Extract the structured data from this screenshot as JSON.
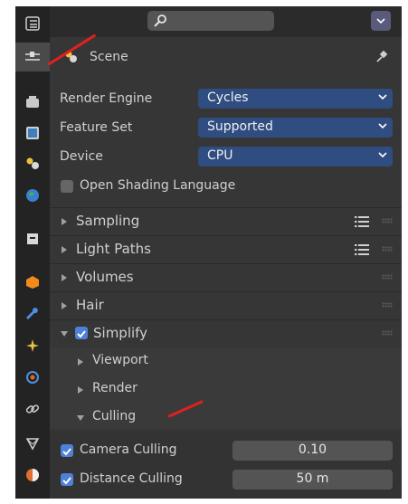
{
  "header": {
    "search_icon": "search-icon"
  },
  "scene": {
    "label": "Scene"
  },
  "render": {
    "engine_label": "Render Engine",
    "engine_value": "Cycles",
    "feature_label": "Feature Set",
    "feature_value": "Supported",
    "device_label": "Device",
    "device_value": "CPU",
    "osl_label": "Open Shading Language"
  },
  "panels": {
    "sampling": "Sampling",
    "light_paths": "Light Paths",
    "volumes": "Volumes",
    "hair": "Hair",
    "simplify": "Simplify",
    "viewport": "Viewport",
    "render": "Render",
    "culling": "Culling"
  },
  "culling": {
    "camera_label": "Camera Culling",
    "camera_value": "0.10",
    "distance_label": "Distance Culling",
    "distance_value": "50 m"
  },
  "colors": {
    "accent": "#2f4d80",
    "checkbox": "#4d82d6",
    "annotation": "#e02020"
  }
}
